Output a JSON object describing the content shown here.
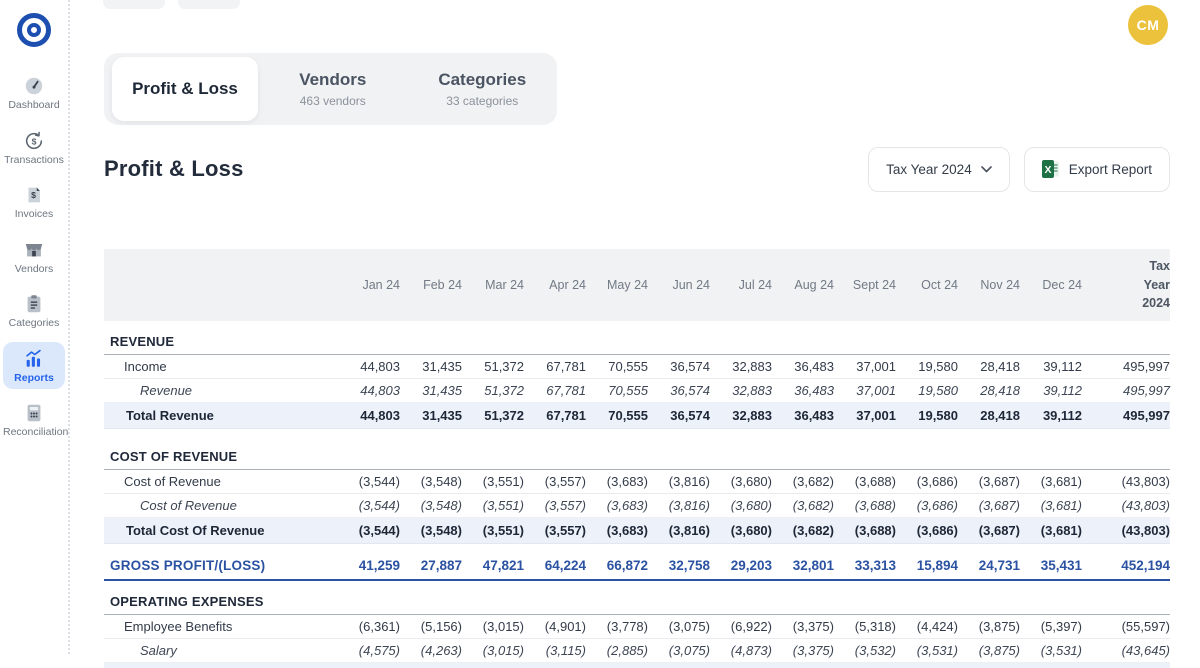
{
  "colors": {
    "accent_blue": "#2563eb",
    "brand_navy": "#1d4fb0",
    "gross_profit_blue": "#2b52a2",
    "total_row_bg": "#edf1f9",
    "avatar_yellow": "#ecc13c",
    "excel_green": "#1e7145"
  },
  "header": {
    "avatar_initials": "CM"
  },
  "sidebar": {
    "items": [
      {
        "label": "Dashboard",
        "icon": "gauge-icon",
        "active": false
      },
      {
        "label": "Transactions",
        "icon": "refresh-dollar-icon",
        "active": false
      },
      {
        "label": "Invoices",
        "icon": "invoice-icon",
        "active": false
      },
      {
        "label": "Vendors",
        "icon": "storefront-icon",
        "active": false
      },
      {
        "label": "Categories",
        "icon": "clipboard-icon",
        "active": false
      },
      {
        "label": "Reports",
        "icon": "bar-chart-icon",
        "active": true
      },
      {
        "label": "Reconciliation",
        "icon": "calculator-icon",
        "active": false
      }
    ]
  },
  "tabs": [
    {
      "label": "Profit & Loss",
      "sublabel": "",
      "active": true
    },
    {
      "label": "Vendors",
      "sublabel": "463 vendors",
      "active": false
    },
    {
      "label": "Categories",
      "sublabel": "33 categories",
      "active": false
    }
  ],
  "page": {
    "title": "Profit & Loss",
    "year_selector": "Tax Year 2024",
    "export_label": "Export Report"
  },
  "table": {
    "columns": [
      "Jan 24",
      "Feb 24",
      "Mar 24",
      "Apr 24",
      "May 24",
      "Jun 24",
      "Jul 24",
      "Aug 24",
      "Sept 24",
      "Oct 24",
      "Nov 24",
      "Dec 24",
      "Tax Year 2024"
    ],
    "rows": [
      {
        "type": "section",
        "label": "REVENUE"
      },
      {
        "type": "item",
        "label": "Income",
        "values": [
          "44,803",
          "31,435",
          "51,372",
          "67,781",
          "70,555",
          "36,574",
          "32,883",
          "36,483",
          "37,001",
          "19,580",
          "28,418",
          "39,112",
          "495,997"
        ]
      },
      {
        "type": "subitem",
        "label": "Revenue",
        "values": [
          "44,803",
          "31,435",
          "51,372",
          "67,781",
          "70,555",
          "36,574",
          "32,883",
          "36,483",
          "37,001",
          "19,580",
          "28,418",
          "39,112",
          "495,997"
        ]
      },
      {
        "type": "total",
        "label": "Total Revenue",
        "values": [
          "44,803",
          "31,435",
          "51,372",
          "67,781",
          "70,555",
          "36,574",
          "32,883",
          "36,483",
          "37,001",
          "19,580",
          "28,418",
          "39,112",
          "495,997"
        ]
      },
      {
        "type": "gap"
      },
      {
        "type": "section",
        "label": "COST OF REVENUE"
      },
      {
        "type": "item",
        "label": "Cost of Revenue",
        "values": [
          "(3,544)",
          "(3,548)",
          "(3,551)",
          "(3,557)",
          "(3,683)",
          "(3,816)",
          "(3,680)",
          "(3,682)",
          "(3,688)",
          "(3,686)",
          "(3,687)",
          "(3,681)",
          "(43,803)"
        ]
      },
      {
        "type": "subitem",
        "label": "Cost of Revenue",
        "values": [
          "(3,544)",
          "(3,548)",
          "(3,551)",
          "(3,557)",
          "(3,683)",
          "(3,816)",
          "(3,680)",
          "(3,682)",
          "(3,688)",
          "(3,686)",
          "(3,687)",
          "(3,681)",
          "(43,803)"
        ]
      },
      {
        "type": "total",
        "label": "Total Cost Of Revenue",
        "values": [
          "(3,544)",
          "(3,548)",
          "(3,551)",
          "(3,557)",
          "(3,683)",
          "(3,816)",
          "(3,680)",
          "(3,682)",
          "(3,688)",
          "(3,686)",
          "(3,687)",
          "(3,681)",
          "(43,803)"
        ]
      },
      {
        "type": "gap"
      },
      {
        "type": "gross",
        "label": "GROSS PROFIT/(LOSS)",
        "values": [
          "41,259",
          "27,887",
          "47,821",
          "64,224",
          "66,872",
          "32,758",
          "29,203",
          "32,801",
          "33,313",
          "15,894",
          "24,731",
          "35,431",
          "452,194"
        ]
      },
      {
        "type": "section",
        "label": "OPERATING EXPENSES"
      },
      {
        "type": "item",
        "label": "Employee Benefits",
        "values": [
          "(6,361)",
          "(5,156)",
          "(3,015)",
          "(4,901)",
          "(3,778)",
          "(3,075)",
          "(6,922)",
          "(3,375)",
          "(5,318)",
          "(4,424)",
          "(3,875)",
          "(5,397)",
          "(55,597)"
        ]
      },
      {
        "type": "subitem",
        "label": "Salary",
        "values": [
          "(4,575)",
          "(4,263)",
          "(3,015)",
          "(3,115)",
          "(2,885)",
          "(3,075)",
          "(4,873)",
          "(3,375)",
          "(3,532)",
          "(3,531)",
          "(3,875)",
          "(3,531)",
          "(43,645)"
        ]
      },
      {
        "type": "partial"
      }
    ]
  }
}
